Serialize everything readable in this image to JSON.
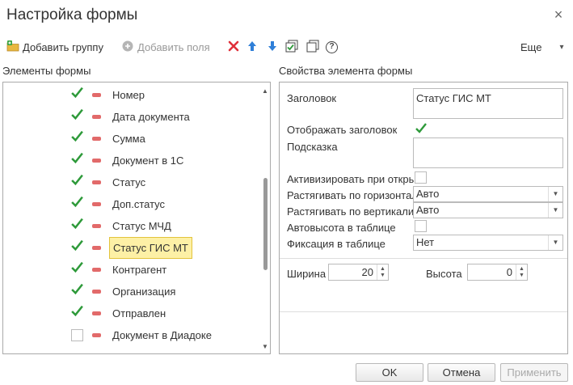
{
  "dialog": {
    "title": "Настройка формы",
    "close": "×"
  },
  "toolbar": {
    "add_group": "Добавить группу",
    "add_fields": "Добавить поля",
    "more": "Еще",
    "more_arrow": "▾",
    "help": "?"
  },
  "left": {
    "title": "Элементы формы",
    "items": [
      {
        "label": "Номер",
        "checked": true
      },
      {
        "label": "Дата документа",
        "checked": true
      },
      {
        "label": "Сумма",
        "checked": true
      },
      {
        "label": "Документ в 1С",
        "checked": true
      },
      {
        "label": "Статус",
        "checked": true
      },
      {
        "label": "Доп.статус",
        "checked": true
      },
      {
        "label": "Статус МЧД",
        "checked": true
      },
      {
        "label": "Статус ГИС МТ",
        "checked": true,
        "selected": true
      },
      {
        "label": "Контрагент",
        "checked": true
      },
      {
        "label": "Организация",
        "checked": true
      },
      {
        "label": "Отправлен",
        "checked": true
      },
      {
        "label": "Документ в Диадоке",
        "checked": false
      }
    ]
  },
  "right": {
    "title": "Свойства элемента формы",
    "header_label": "Заголовок",
    "header_value": "Статус ГИС МТ",
    "show_header_label": "Отображать заголовок",
    "show_header_checked": true,
    "hint_label": "Подсказка",
    "hint_value": "",
    "activate_label": "Активизировать при откры",
    "activate_checked": false,
    "stretch_h_label": "Растягивать по горизонтал",
    "stretch_h_value": "Авто",
    "stretch_v_label": "Растягивать по вертикали",
    "stretch_v_value": "Авто",
    "autoheight_label": "Автовысота в таблице",
    "autoheight_checked": false,
    "fix_label": "Фиксация в таблице",
    "fix_value": "Нет",
    "width_label": "Ширина",
    "width_value": "20",
    "height_label": "Высота",
    "height_value": "0"
  },
  "footer": {
    "ok": "OK",
    "cancel": "Отмена",
    "apply": "Применить"
  },
  "colors": {
    "accent_green": "#2e9a3a",
    "remove_red": "#e26a6a",
    "selected_bg": "#fdf0a6"
  }
}
